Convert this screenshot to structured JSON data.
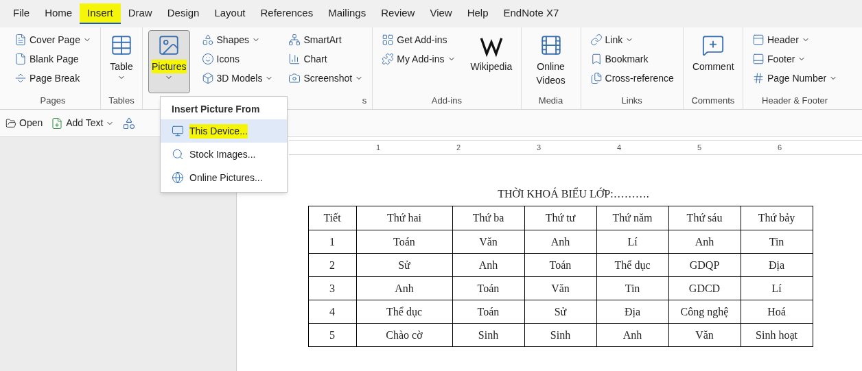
{
  "menu_tabs": [
    {
      "label": "File",
      "selected": false,
      "highlighted": false
    },
    {
      "label": "Home",
      "selected": false,
      "highlighted": false
    },
    {
      "label": "Insert",
      "selected": true,
      "highlighted": true
    },
    {
      "label": "Draw",
      "selected": false,
      "highlighted": false
    },
    {
      "label": "Design",
      "selected": false,
      "highlighted": false
    },
    {
      "label": "Layout",
      "selected": false,
      "highlighted": false
    },
    {
      "label": "References",
      "selected": false,
      "highlighted": false
    },
    {
      "label": "Mailings",
      "selected": false,
      "highlighted": false
    },
    {
      "label": "Review",
      "selected": false,
      "highlighted": false
    },
    {
      "label": "View",
      "selected": false,
      "highlighted": false
    },
    {
      "label": "Help",
      "selected": false,
      "highlighted": false
    },
    {
      "label": "EndNote X7",
      "selected": false,
      "highlighted": false
    }
  ],
  "ribbon_groups": [
    {
      "label": "Pages",
      "columns": [
        [
          {
            "kind": "small",
            "label": "Cover Page",
            "dropdown": true,
            "highlighted": false,
            "pressed": false
          },
          {
            "kind": "small",
            "label": "Blank Page",
            "dropdown": false,
            "highlighted": false,
            "pressed": false
          },
          {
            "kind": "small",
            "label": "Page Break",
            "dropdown": false,
            "highlighted": false,
            "pressed": false
          }
        ]
      ]
    },
    {
      "label": "Tables",
      "columns": [
        [
          {
            "kind": "large",
            "label": "Table",
            "dropdown": true,
            "highlighted": false,
            "pressed": false
          }
        ]
      ]
    },
    {
      "label": "s",
      "columns": [
        [
          {
            "kind": "large",
            "label": "Pictures",
            "dropdown": true,
            "highlighted": true,
            "pressed": true
          }
        ],
        [
          {
            "kind": "small",
            "label": "Shapes",
            "dropdown": true,
            "highlighted": false,
            "pressed": false
          },
          {
            "kind": "small",
            "label": "Icons",
            "dropdown": false,
            "highlighted": false,
            "pressed": false
          },
          {
            "kind": "small",
            "label": "3D Models",
            "dropdown": true,
            "highlighted": false,
            "pressed": false
          }
        ],
        [
          {
            "kind": "small",
            "label": "SmartArt",
            "dropdown": false,
            "highlighted": false,
            "pressed": false
          },
          {
            "kind": "small",
            "label": "Chart",
            "dropdown": false,
            "highlighted": false,
            "pressed": false
          },
          {
            "kind": "small",
            "label": "Screenshot",
            "dropdown": true,
            "highlighted": false,
            "pressed": false
          }
        ]
      ]
    },
    {
      "label": "Add-ins",
      "columns": [
        [
          {
            "kind": "small",
            "label": "Get Add-ins",
            "dropdown": false,
            "highlighted": false,
            "pressed": false
          },
          {
            "kind": "small",
            "label": "My Add-ins",
            "dropdown": true,
            "highlighted": false,
            "pressed": false
          }
        ],
        [
          {
            "kind": "large",
            "label": "Wikipedia",
            "dropdown": false,
            "highlighted": false,
            "pressed": false
          }
        ]
      ]
    },
    {
      "label": "Media",
      "columns": [
        [
          {
            "kind": "large",
            "label": "Online Videos",
            "dropdown": false,
            "highlighted": false,
            "pressed": false
          }
        ]
      ]
    },
    {
      "label": "Links",
      "columns": [
        [
          {
            "kind": "small",
            "label": "Link",
            "dropdown": true,
            "highlighted": false,
            "pressed": false
          },
          {
            "kind": "small",
            "label": "Bookmark",
            "dropdown": false,
            "highlighted": false,
            "pressed": false
          },
          {
            "kind": "small",
            "label": "Cross-reference",
            "dropdown": false,
            "highlighted": false,
            "pressed": false
          }
        ]
      ]
    },
    {
      "label": "Comments",
      "columns": [
        [
          {
            "kind": "large",
            "label": "Comment",
            "dropdown": false,
            "highlighted": false,
            "pressed": false
          }
        ]
      ]
    },
    {
      "label": "Header & Footer",
      "columns": [
        [
          {
            "kind": "small",
            "label": "Header",
            "dropdown": true,
            "highlighted": false,
            "pressed": false
          },
          {
            "kind": "small",
            "label": "Footer",
            "dropdown": true,
            "highlighted": false,
            "pressed": false
          },
          {
            "kind": "small",
            "label": "Page Number",
            "dropdown": true,
            "highlighted": false,
            "pressed": false
          }
        ]
      ]
    }
  ],
  "toolbar": [
    {
      "label": "Open",
      "dropdown": false
    },
    {
      "label": "Add Text",
      "dropdown": true
    }
  ],
  "picture_menu": {
    "title": "Insert Picture From",
    "items": [
      {
        "label": "This Device...",
        "selected": true,
        "highlighted": true
      },
      {
        "label": "Stock Images...",
        "selected": false,
        "highlighted": false
      },
      {
        "label": "Online Pictures...",
        "selected": false,
        "highlighted": false
      }
    ]
  },
  "ruler": {
    "numbers": [
      "1",
      "2",
      "3",
      "4",
      "5",
      "6"
    ]
  },
  "document": {
    "title": "THỜI KHOÁ BIỂU LỚP:……….",
    "table": {
      "columns": [
        "Tiết",
        "Thứ hai",
        "Thứ ba",
        "Thứ tư",
        "Thứ năm",
        "Thứ sáu",
        "Thứ bảy"
      ],
      "rows": [
        [
          "1",
          "Toán",
          "Văn",
          "Anh",
          "Lí",
          "Anh",
          "Tin"
        ],
        [
          "2",
          "Sử",
          "Anh",
          "Toán",
          "Thể dục",
          "GDQP",
          "Địa"
        ],
        [
          "3",
          "Anh",
          "Toán",
          "Văn",
          "Tin",
          "GDCD",
          "Lí"
        ],
        [
          "4",
          "Thể dục",
          "Toán",
          "Sử",
          "Địa",
          "Công nghệ",
          "Hoá"
        ],
        [
          "5",
          "Chào cờ",
          "Sinh",
          "Sinh",
          "Anh",
          "Văn",
          "Sinh hoạt"
        ]
      ]
    }
  }
}
